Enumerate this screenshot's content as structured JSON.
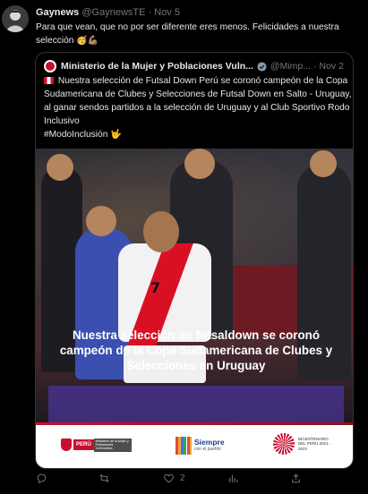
{
  "tweet": {
    "display_name": "Gaynews",
    "handle": "@GaynewsTE",
    "separator": "·",
    "date": "Nov 5",
    "text": "Para que vean, que no por ser diferente eres menos. Felicidades a nuestra selección",
    "text_emojis": "🥳💪🏽"
  },
  "quoted": {
    "display_name": "Ministerio de la Mujer y Poblaciones Vuln...",
    "handle": "@Mimp...",
    "separator": "·",
    "date": "Nov 2",
    "text": "Nuestra selección de Futsal Down Perú se coronó campeón de la Copa Sudamericana de Clubes y Selecciones de Futsal Down en Salto - Uruguay, al ganar sendos partidos a la selección de Uruguay y al Club Sportivo Rodo Inclusivo",
    "hashtag": "#ModoInclusión",
    "hashtag_emoji": "🤟",
    "image": {
      "banner_text": "Nuestra selección de futsaldown se coronó campeón de la Copa Sudamericana de Clubes y Selecciones en Uruguay",
      "jersey_number": "7",
      "logo_peru": "PERÚ",
      "logo_ministry": "Ministerio de la Mujer y Poblaciones Vulnerables",
      "logo_siempre": "Siempre",
      "logo_siempre_sub": "con el pueblo",
      "logo_bicentenario": "BICENTENARIO DEL PERÚ 2021 - 2024"
    }
  },
  "actions": {
    "reply_count": "",
    "retweet_count": "",
    "like_count": "2",
    "views_count": ""
  },
  "colors": {
    "background": "#000000",
    "text_primary": "#e7e9ea",
    "text_secondary": "#71767b",
    "border": "#2f3336",
    "banner": "#46328c",
    "peru_red": "#d91023"
  }
}
